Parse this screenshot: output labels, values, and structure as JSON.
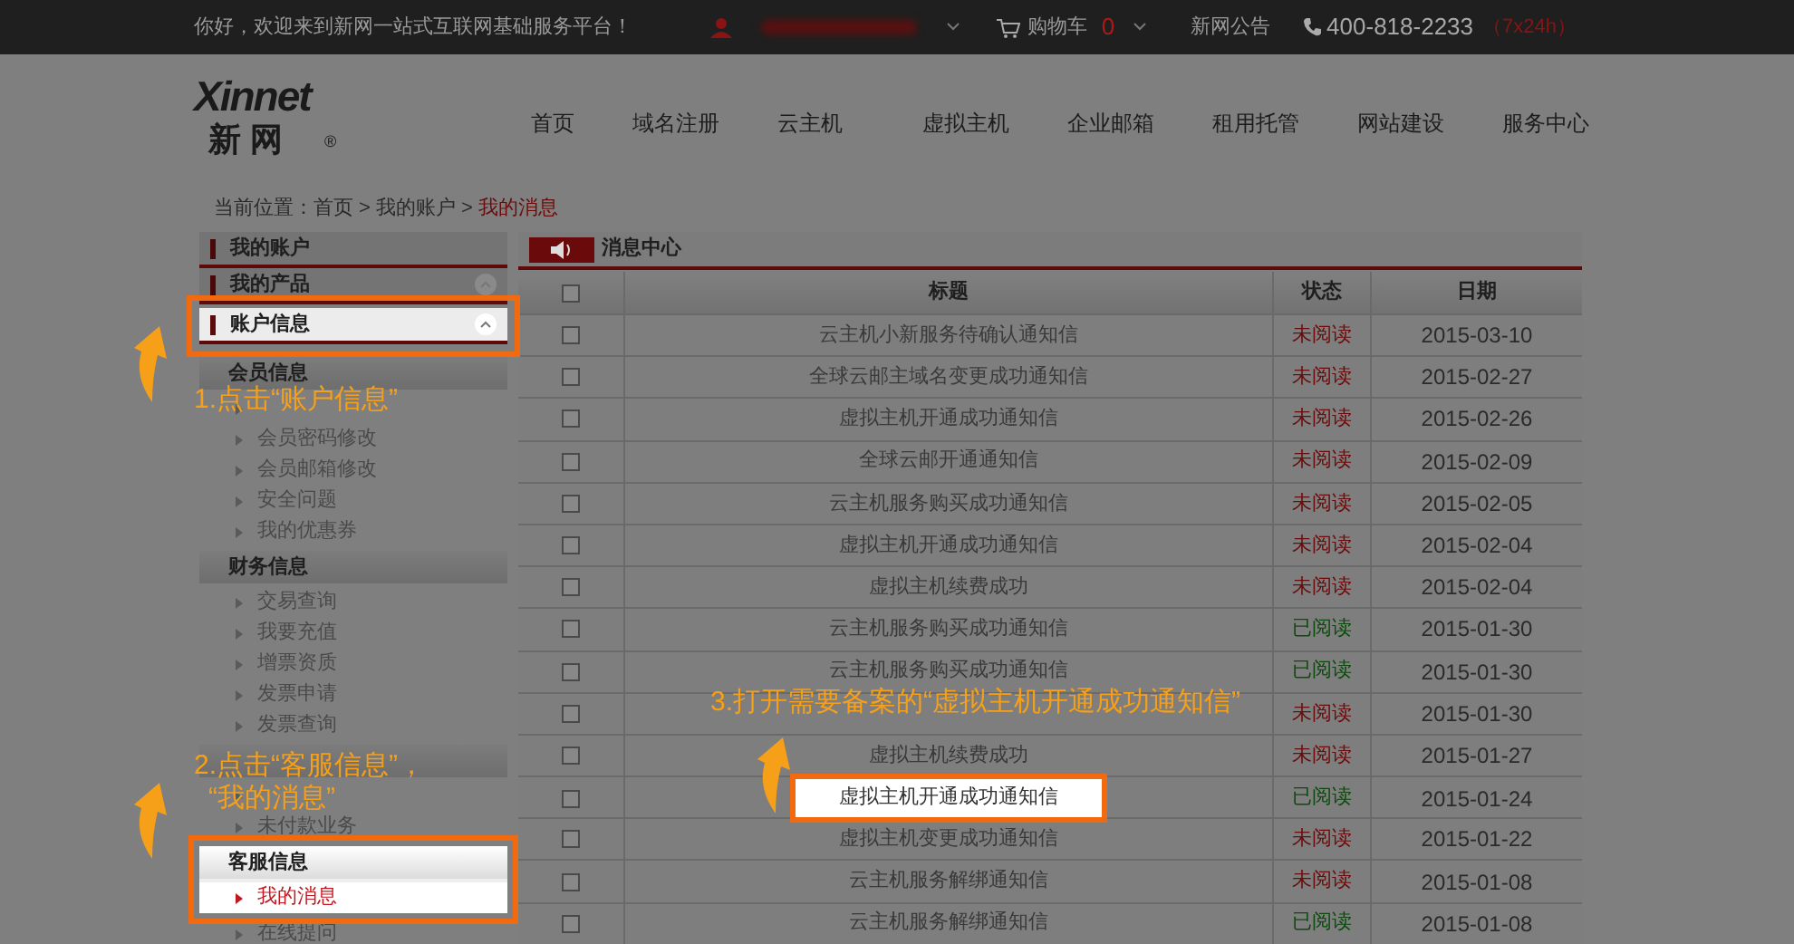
{
  "top_bar": {
    "welcome": "你好，欢迎来到新网一站式互联网基础服务平台！",
    "cart_label": "购物车",
    "cart_count": "0",
    "notice": "新网公告",
    "phone": "400-818-2233",
    "hours": "（7x24h）"
  },
  "logo": {
    "wordmark": "Xinnet",
    "chinese": "新 网",
    "mark": "®"
  },
  "nav": [
    "首页",
    "域名注册",
    "云主机",
    "虚拟主机",
    "企业邮箱",
    "租用托管",
    "网站建设",
    "服务中心"
  ],
  "breadcrumb": {
    "prefix": "当前位置：",
    "items": [
      {
        "label": "首页",
        "current": false
      },
      {
        "separator": ">",
        "label": "我的账户",
        "current": false
      },
      {
        "separator": ">",
        "label": "我的消息",
        "current": true
      }
    ]
  },
  "sidebar": [
    {
      "label": "我的账户",
      "collapse_icon": false,
      "highlighted": false
    },
    {
      "label": "我的产品",
      "collapse_icon": true,
      "highlighted": false
    },
    {
      "label": "账户信息",
      "collapse_icon": true,
      "highlighted": true,
      "groups": [
        {
          "label": "会员信息",
          "highlighted": false,
          "items": [
            {
              "selected": false
            },
            {
              "label": "会员密码修改",
              "selected": false
            },
            {
              "label": "会员邮箱修改",
              "selected": false
            },
            {
              "label": "安全问题",
              "selected": false
            },
            {
              "label": "我的优惠券",
              "selected": false
            }
          ]
        },
        {
          "label": "财务信息",
          "highlighted": false,
          "items": [
            {
              "label": "交易查询",
              "selected": false
            },
            {
              "label": "我要充值",
              "selected": false
            },
            {
              "label": "增票资质",
              "selected": false
            },
            {
              "label": "发票申请",
              "selected": false
            },
            {
              "label": "发票查询",
              "selected": false
            }
          ]
        },
        {
          "highlighted": false,
          "items": [
            {
              "selected": false
            },
            {
              "label": "未付款业务",
              "selected": false
            }
          ]
        },
        {
          "label": "客服信息",
          "highlighted": true,
          "items": [
            {
              "label": "我的消息",
              "selected": true
            },
            {
              "label": "在线提问",
              "selected": false
            }
          ]
        }
      ]
    }
  ],
  "messages": {
    "title": "消息中心",
    "select_all_checked": false,
    "columns": [
      "标题",
      "状态",
      "日期"
    ],
    "rows": [
      {
        "checked": false,
        "title": "云主机小新服务待确认通知信",
        "status": "未阅读",
        "read": false,
        "date": "2015-03-10",
        "highlighted": false
      },
      {
        "checked": false,
        "title": "全球云邮主域名变更成功通知信",
        "status": "未阅读",
        "read": false,
        "date": "2015-02-27",
        "highlighted": false
      },
      {
        "checked": false,
        "title": "虚拟主机开通成功通知信",
        "status": "未阅读",
        "read": false,
        "date": "2015-02-26",
        "highlighted": false
      },
      {
        "checked": false,
        "title": "全球云邮开通通知信",
        "status": "未阅读",
        "read": false,
        "date": "2015-02-09",
        "highlighted": false
      },
      {
        "checked": false,
        "title": "云主机服务购买成功通知信",
        "status": "未阅读",
        "read": false,
        "date": "2015-02-05",
        "highlighted": false
      },
      {
        "checked": false,
        "title": "虚拟主机开通成功通知信",
        "status": "未阅读",
        "read": false,
        "date": "2015-02-04",
        "highlighted": false
      },
      {
        "checked": false,
        "title": "虚拟主机续费成功",
        "status": "未阅读",
        "read": false,
        "date": "2015-02-04",
        "highlighted": false
      },
      {
        "checked": false,
        "title": "云主机服务购买成功通知信",
        "status": "已阅读",
        "read": true,
        "date": "2015-01-30",
        "highlighted": false
      },
      {
        "checked": false,
        "title": "云主机服务购买成功通知信",
        "status": "已阅读",
        "read": true,
        "date": "2015-01-30",
        "highlighted": false
      },
      {
        "checked": false,
        "status": "未阅读",
        "read": false,
        "date": "2015-01-30"
      },
      {
        "checked": false,
        "title": "虚拟主机续费成功",
        "status": "未阅读",
        "read": false,
        "date": "2015-01-27",
        "highlighted": false
      },
      {
        "checked": false,
        "title": "虚拟主机开通成功通知信",
        "status": "已阅读",
        "read": true,
        "date": "2015-01-24",
        "highlighted": true
      },
      {
        "checked": false,
        "title": "虚拟主机变更成功通知信",
        "status": "未阅读",
        "read": false,
        "date": "2015-01-22",
        "highlighted": false
      },
      {
        "checked": false,
        "title": "云主机服务解绑通知信",
        "status": "未阅读",
        "read": false,
        "date": "2015-01-08",
        "highlighted": false
      },
      {
        "checked": false,
        "title": "云主机服务解绑通知信",
        "status": "已阅读",
        "read": true,
        "date": "2015-01-08",
        "highlighted": false
      }
    ]
  },
  "callouts": [
    {
      "lines": [
        "1.点击“账户信息”"
      ]
    },
    {
      "lines": [
        "2.点击“客服信息”，",
        "“我的消息”"
      ]
    },
    {
      "lines": [
        "3.打开需要备案的“虚拟主机开通成功通知信”"
      ]
    }
  ]
}
